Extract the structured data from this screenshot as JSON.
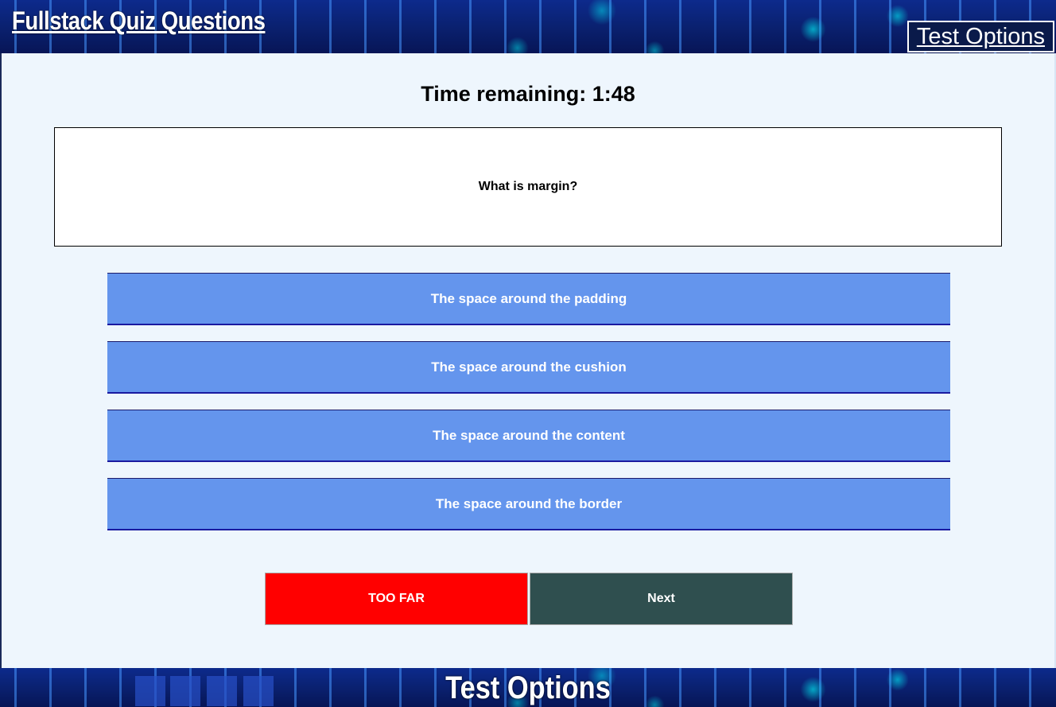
{
  "header": {
    "title": "Fullstack Quiz Questions",
    "options_link": "Test Options"
  },
  "quiz": {
    "timer_text": "Time remaining: 1:48",
    "question": "What is margin?",
    "answers": [
      "The space around the padding",
      "The space around the cushion",
      "The space around the content",
      "The space around the border"
    ],
    "too_far_label": "TOO FAR",
    "next_label": "Next"
  },
  "footer": {
    "title": "Test Options"
  },
  "colors": {
    "answer_bg": "#6495ed",
    "too_far_bg": "#ff0000",
    "next_bg": "#2f4f4f",
    "page_bg": "#eef6fd"
  }
}
